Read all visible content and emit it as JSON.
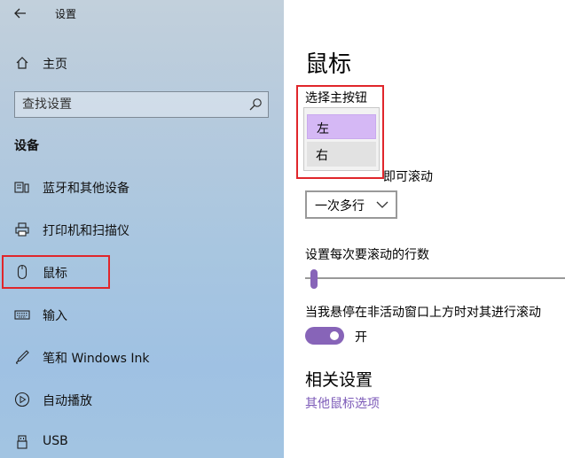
{
  "window": {
    "title": "设置",
    "back_icon": "arrow-left-icon"
  },
  "sidebar": {
    "home": {
      "label": "主页",
      "icon": "home-icon"
    },
    "search": {
      "placeholder": "查找设置",
      "icon": "search-icon"
    },
    "section_title": "设备",
    "items": [
      {
        "label": "蓝牙和其他设备",
        "icon": "bluetooth-devices-icon"
      },
      {
        "label": "打印机和扫描仪",
        "icon": "printer-icon"
      },
      {
        "label": "鼠标",
        "icon": "mouse-icon",
        "selected": true
      },
      {
        "label": "输入",
        "icon": "keyboard-icon"
      },
      {
        "label": "笔和 Windows Ink",
        "icon": "pen-icon"
      },
      {
        "label": "自动播放",
        "icon": "autoplay-icon"
      },
      {
        "label": "USB",
        "icon": "usb-icon"
      }
    ]
  },
  "main": {
    "title": "鼠标",
    "primary_button": {
      "label": "选择主按钮",
      "options": [
        "左",
        "右"
      ],
      "selected": "左"
    },
    "wheel_scroll": {
      "label_visible_part": "即可滚动",
      "value": "一次多行"
    },
    "lines_to_scroll": {
      "label": "设置每次要滚动的行数",
      "value_fraction": 0.01
    },
    "inactive_scroll": {
      "label": "当我悬停在非活动窗口上方时对其进行滚动",
      "toggle_state_label": "开",
      "on": true
    },
    "related": {
      "title": "相关设置",
      "link": "其他鼠标选项"
    }
  },
  "colors": {
    "accent": "#8764b8",
    "highlight_border": "#e0262b",
    "selected_option_bg": "#d5b8f5",
    "link": "#7c5ab8"
  }
}
